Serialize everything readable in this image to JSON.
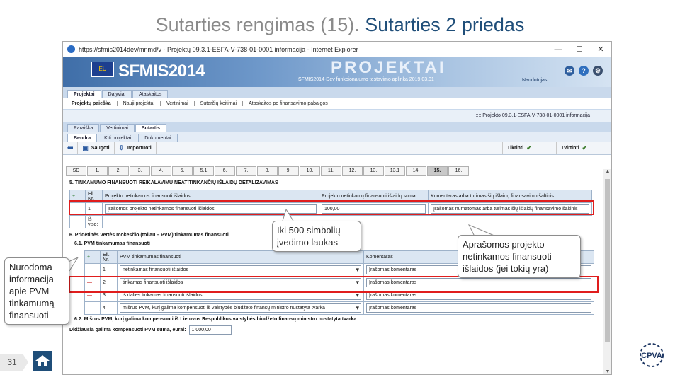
{
  "slide": {
    "title_part1": "Sutarties rengimas (15). ",
    "title_part2": "Sutarties 2 priedas",
    "page_number": "31"
  },
  "browser": {
    "title": "https://sfmis2014dev/mnmd/v - Projektų 09.3.1-ESFA-V-738-01-0001 informacija - Internet Explorer",
    "minimize": "—",
    "maximize": "☐",
    "close": "✕"
  },
  "app": {
    "logo": "SFMIS2014",
    "eu_flag": "EU",
    "banner_title": "PROJEKTAI",
    "banner_subtitle": "SFMIS2014-Dev funkcionalumo testavimo aplinka 2019.03.01",
    "user_label": "Naudotojas:",
    "info_line": ":::: Projekto 09.3.1-ESFA-V-738-01-0001 informacija",
    "top_tabs": [
      "Projektai",
      "Dalyviai",
      "Ataskaitos"
    ],
    "sub_menu": [
      "Projektų paieška",
      "Nauji projektai",
      "Vertinimai",
      "Sutarčių keitimai",
      "Ataskaitos po finansavimo pabaigos"
    ],
    "tabs3": [
      "Paraiška",
      "Vertinimai",
      "Sutartis"
    ],
    "tabs4": [
      "Bendra",
      "Kiti projektai",
      "Dokumentai"
    ],
    "toolbar": {
      "save": "Saugoti",
      "import": "Importuoti",
      "check": "Tikrinti",
      "approve": "Tvirtinti"
    },
    "steps": [
      "SD",
      "1.",
      "2.",
      "3.",
      "4.",
      "5.",
      "5.1",
      "6.",
      "7.",
      "8.",
      "9.",
      "10.",
      "11.",
      "12.",
      "13.",
      "13.1",
      "14.",
      "15.",
      "16."
    ],
    "active_step": "15."
  },
  "section5": {
    "heading": "5. TINKAMUMO FINANSUOTI REIKALAVIMŲ NEATITINKANČIŲ IŠLAIDŲ DETALIZAVIMAS",
    "col_no": "Eil. Nr.",
    "col_expense": "Projekto netinkamos finansuoti išlaidos",
    "col_amount": "Projekto netinkamų finansuoti išlaidų suma",
    "col_source": "Komentaras arba turimas šių išlaidų finansavimo šaltinis",
    "row_no": "1",
    "row_expense": "Įrašomos projekto netinkamos finansuoti išlaidos",
    "row_amount": "100,00",
    "row_source": "Įrašomas numatomas arba turimas šių išlaidų finansavimo šaltinis",
    "total_label": "Iš viso:"
  },
  "section6": {
    "heading": "6. Pridėtinės vertės mokesčio (toliau – PVM) tinkamumas finansuoti",
    "sub_heading": "6.1. PVM tinkamumas finansuoti",
    "col_no": "Eil. Nr.",
    "col_vat": "PVM tinkamumas finansuoti",
    "col_comment": "Komentaras",
    "rows": [
      {
        "no": "1",
        "vat": "netinkamas finansuoti išlaidos",
        "comment": "Įrašomas komentaras"
      },
      {
        "no": "2",
        "vat": "tinkamas finansuoti išlaidos",
        "comment": "Įrašomas komentaras"
      },
      {
        "no": "3",
        "vat": "iš dalies tinkamas finansuoti išlaidos",
        "comment": "Įrašomas komentaras"
      },
      {
        "no": "4",
        "vat": "mišrus PVM, kurį galima kompensuoti iš valstybės biudžeto finansų ministro nustatyta tvarka",
        "comment": "Įrašomas komentaras"
      }
    ],
    "section62": "6.2. Mišrus PVM, kurį galima kompensuoti iš Lietuvos Respublikos valstybės biudžeto finansų ministro nustatyta tvarka",
    "max_label": "Didžiausia galima kompensuoti PVM suma, eurai:",
    "max_value": "1.000,00"
  },
  "callouts": {
    "chars": "Iki 500 simbolių įvedimo laukas",
    "ineligible": "Aprašomos projekto netinkamos finansuoti išlaidos (jei tokių yra)",
    "vat": "Nurodoma informacija apie PVM tinkamumą finansuoti"
  },
  "logo_text": "CPVA",
  "colors": {
    "highlight": "#e01d1d",
    "title_accent": "#1f4e79",
    "banner": "#3f6ea8"
  }
}
